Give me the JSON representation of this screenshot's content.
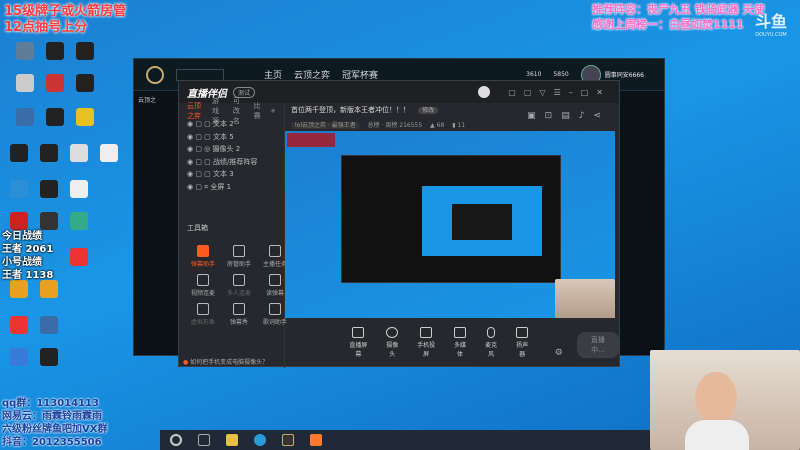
{
  "overlay": {
    "left_title_1": "15级牌子或火箭房管",
    "left_title_2": "12点抽号上分",
    "stats": [
      "今日战绩",
      "王者 2061",
      "小号战绩",
      "王者 1138"
    ],
    "contacts": [
      "qq群：113014113",
      "网易云：雨霖铃雨霖雨",
      "六级粉丝牌鱼吧加VX群",
      "抖音：2012355506"
    ],
    "right_line_1": "推荐阵容：丧尸九五 铁骑武器 天使",
    "right_line_2": "感谢上周榜一：白昼如焚1111",
    "watermark": "斗鱼",
    "watermark_sub": "DOUYU.COM"
  },
  "game_client": {
    "nav": [
      "主页",
      "云顶之弈",
      "冠军杯赛"
    ],
    "currency_1": "3610",
    "currency_2": "5850",
    "player": "圆事同安6666",
    "side_item": "云顶之"
  },
  "stream_app": {
    "logo": "直播伴侣",
    "badge": "测试",
    "scene_tabs": [
      "云顶之弈",
      "游戏源",
      "可改名",
      "比赛"
    ],
    "sources": [
      "文本 2",
      "文本 5",
      "摄像头 2",
      "战绩/推荐阵容",
      "文本 3",
      "全屏 1"
    ],
    "room_title": "首位两千登顶，新版本王者冲位！！！",
    "edit_label": "修改",
    "category": "lol云顶之弈 · 最强王者",
    "room_info": "总榜 · 周榜 216555",
    "hot": "68",
    "fans": "11",
    "toolbox_title": "工具箱",
    "tools": [
      "弹幕助手",
      "房管助手",
      "主播任务",
      "视频连麦",
      "多人连麦",
      "读弹幕",
      "虚拟形象",
      "弹幕秀",
      "歌词助手"
    ],
    "tip": "如何把手机变成电脑摄像头？",
    "controls": [
      "直播屏幕",
      "摄像头",
      "手机投屏",
      "多媒体",
      "麦克风",
      "扬声器"
    ],
    "live_button": "直播中..."
  },
  "colors": {
    "accent": "#ff5a1f",
    "desktop": "#1a8fd8"
  }
}
